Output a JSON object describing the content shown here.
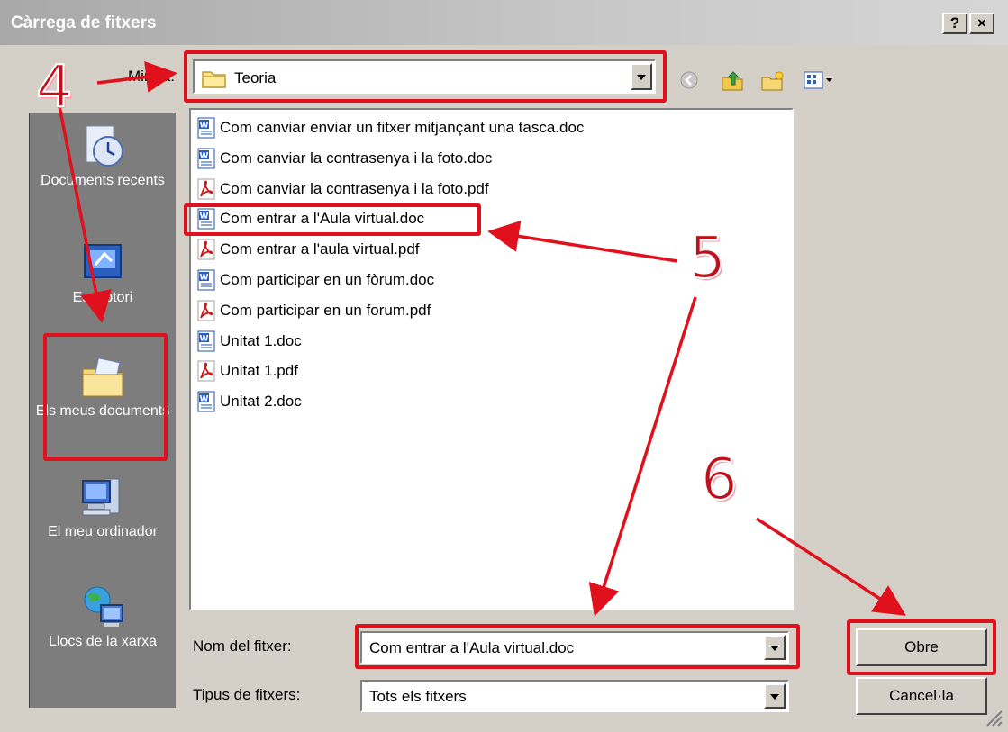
{
  "window": {
    "title": "Càrrega de fitxers",
    "help_button": "?",
    "close_button": "×"
  },
  "lookin": {
    "label": "Mira a:",
    "value": "Teoria"
  },
  "places": [
    {
      "label": "Documents recents",
      "icon": "recent-documents-icon"
    },
    {
      "label": "Escriptori",
      "icon": "desktop-icon"
    },
    {
      "label": "Els meus documents",
      "icon": "my-documents-icon"
    },
    {
      "label": "El meu ordinador",
      "icon": "my-computer-icon"
    },
    {
      "label": "Llocs de la xarxa",
      "icon": "network-places-icon"
    }
  ],
  "files": [
    {
      "name": "Com canviar enviar un fitxer mitjançant una tasca.doc",
      "type": "doc"
    },
    {
      "name": "Com canviar la contrasenya i la foto.doc",
      "type": "doc"
    },
    {
      "name": "Com canviar la contrasenya i la foto.pdf",
      "type": "pdf"
    },
    {
      "name": "Com entrar a l'Aula virtual.doc",
      "type": "doc"
    },
    {
      "name": "Com entrar a l'aula virtual.pdf",
      "type": "pdf"
    },
    {
      "name": "Com participar en un fòrum.doc",
      "type": "doc"
    },
    {
      "name": "Com participar en un forum.pdf",
      "type": "pdf"
    },
    {
      "name": "Unitat 1.doc",
      "type": "doc"
    },
    {
      "name": "Unitat 1.pdf",
      "type": "pdf"
    },
    {
      "name": "Unitat 2.doc",
      "type": "doc"
    }
  ],
  "filename": {
    "label": "Nom del fitxer:",
    "value": "Com entrar a l'Aula virtual.doc"
  },
  "filetype": {
    "label": "Tipus de fitxers:",
    "value": "Tots els fitxers"
  },
  "buttons": {
    "open": "Obre",
    "cancel": "Cancel·la"
  },
  "annotations": {
    "step4": "4",
    "step5": "5",
    "step6": "6",
    "color": "#e0101c"
  }
}
